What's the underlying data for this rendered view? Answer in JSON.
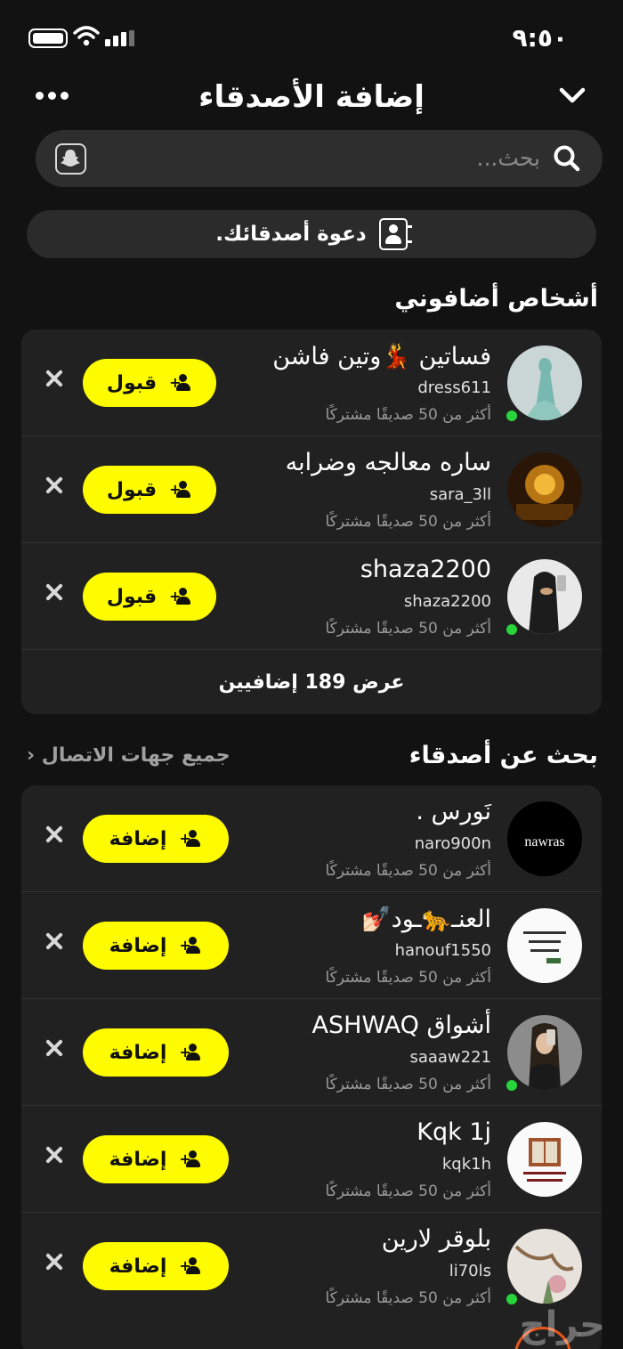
{
  "status": {
    "time": "٩:٥٠"
  },
  "header": {
    "title": "إضافة الأصدقاء"
  },
  "search": {
    "placeholder": "بحث..."
  },
  "invite": {
    "label": "دعوة أصدقائك."
  },
  "added_me": {
    "title": "أشخاص أضافوني",
    "action_label": "قبول",
    "show_more": "عرض 189 إضافيين",
    "items": [
      {
        "name": "فساتين 💃وتين فاشن",
        "username": "dress611",
        "mutual": "أكثر من 50 صديقًا مشتركًا",
        "online": true
      },
      {
        "name": "ساره معالجه وضرابه",
        "username": "sara_3ll",
        "mutual": "أكثر من 50 صديقًا مشتركًا",
        "online": false
      },
      {
        "name": "shaza2200",
        "username": "shaza2200",
        "mutual": "أكثر من 50 صديقًا مشتركًا",
        "online": true
      }
    ]
  },
  "find_friends": {
    "title": "بحث عن أصدقاء",
    "see_all": "جميع جهات الاتصال",
    "action_label": "إضافة",
    "items": [
      {
        "name": "نَورس .",
        "username": "naro900n",
        "mutual": "أكثر من 50 صديقًا مشتركًا",
        "online": false,
        "avatar_text": "nawras"
      },
      {
        "name": "العنـ🐆ـود💅🏻",
        "username": "hanouf1550",
        "mutual": "أكثر من 50 صديقًا مشتركًا",
        "online": false
      },
      {
        "name": "أشواق ASHWAQ",
        "username": "saaaw221",
        "mutual": "أكثر من 50 صديقًا مشتركًا",
        "online": true
      },
      {
        "name": "Kqk 1j",
        "username": "kqk1h",
        "mutual": "أكثر من 50 صديقًا مشتركًا",
        "online": false
      },
      {
        "name": "بلوقر لارين",
        "username": "li70ls",
        "mutual": "أكثر من 50 صديقًا مشتركًا",
        "online": true
      }
    ]
  },
  "watermark": "حراج"
}
